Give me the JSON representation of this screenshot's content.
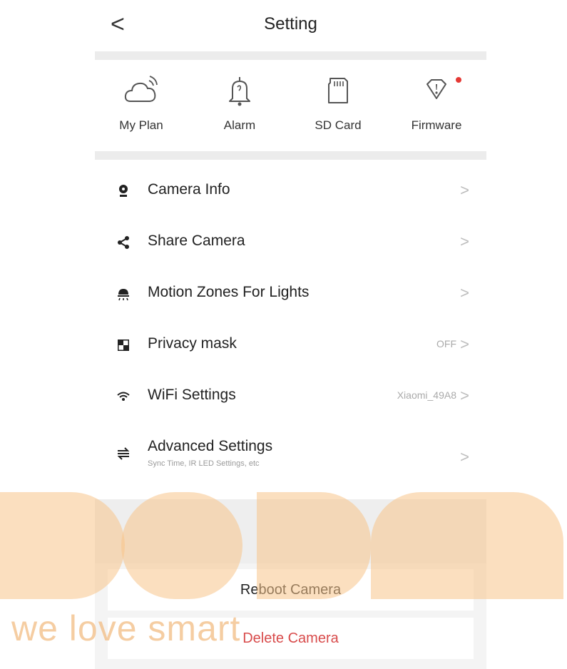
{
  "header": {
    "back_glyph": "<",
    "title": "Setting"
  },
  "quick_actions": [
    {
      "label": "My Plan",
      "icon": "cloud-icon"
    },
    {
      "label": "Alarm",
      "icon": "bell-icon"
    },
    {
      "label": "SD Card",
      "icon": "sd-card-icon"
    },
    {
      "label": "Firmware",
      "icon": "firmware-icon",
      "badge": true
    }
  ],
  "settings_list": [
    {
      "label": "Camera Info",
      "icon": "camera-icon",
      "value": "",
      "sub": ""
    },
    {
      "label": "Share Camera",
      "icon": "share-icon",
      "value": "",
      "sub": ""
    },
    {
      "label": "Motion Zones For Lights",
      "icon": "motion-zone-icon",
      "value": "",
      "sub": ""
    },
    {
      "label": "Privacy mask",
      "icon": "privacy-mask-icon",
      "value": "OFF",
      "sub": ""
    },
    {
      "label": "WiFi Settings",
      "icon": "wifi-icon",
      "value": "Xiaomi_49A8",
      "sub": ""
    },
    {
      "label": "Advanced Settings",
      "icon": "advanced-settings-icon",
      "value": "",
      "sub": "Sync Time, IR LED Settings, etc"
    }
  ],
  "chevron_glyph": ">",
  "actions": {
    "reboot_label": "Reboot Camera",
    "delete_label": "Delete Camera"
  },
  "watermark": {
    "text": "we love smart"
  },
  "colors": {
    "accent_red": "#e53935",
    "delete_text": "#d84b4b",
    "watermark": "#f7c48a"
  }
}
